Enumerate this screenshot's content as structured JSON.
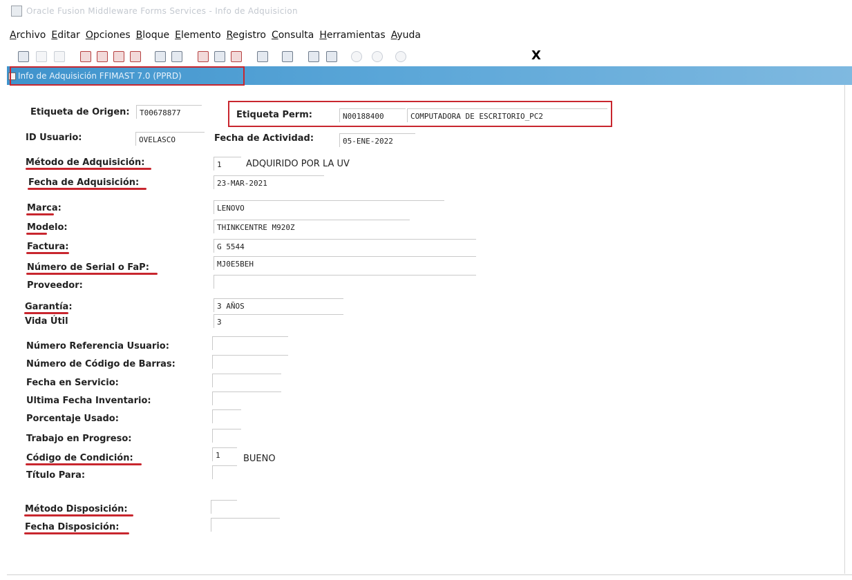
{
  "window": {
    "title": "Oracle Fusion Middleware Forms Services - Info de Adquisicion"
  },
  "menu": [
    {
      "pre": "",
      "mn": "A",
      "post": "rchivo"
    },
    {
      "pre": "",
      "mn": "E",
      "post": "ditar"
    },
    {
      "pre": "",
      "mn": "O",
      "post": "pciones"
    },
    {
      "pre": "",
      "mn": "B",
      "post": "loque"
    },
    {
      "pre": "",
      "mn": "E",
      "post": "lemento"
    },
    {
      "pre": "",
      "mn": "R",
      "post": "egistro"
    },
    {
      "pre": "",
      "mn": "C",
      "post": "onsulta"
    },
    {
      "pre": "",
      "mn": "H",
      "post": "erramientas"
    },
    {
      "pre": "",
      "mn": "A",
      "post": "yuda"
    }
  ],
  "toolbar": {
    "close_label": "X"
  },
  "form": {
    "title": "Info de Adquisición  FFIMAST  7.0  (PPRD)"
  },
  "fields": {
    "etiqueta_origen": {
      "label": "Etiqueta de Origen:",
      "value": "T00678877"
    },
    "etiqueta_perm": {
      "label": "Etiqueta Perm:",
      "code": "N00188400",
      "desc": "COMPUTADORA DE ESCRITORIO_PC2"
    },
    "id_usuario": {
      "label": "ID Usuario:",
      "value": "OVELASCO"
    },
    "fecha_actividad": {
      "label": "Fecha de Actividad:",
      "value": "05-ENE-2022"
    },
    "metodo_adquisicion": {
      "label": "Método de Adquisición:",
      "code": "1",
      "desc": "ADQUIRIDO POR LA UV"
    },
    "fecha_adquisicion": {
      "label": "Fecha de Adquisición:",
      "value": "23-MAR-2021"
    },
    "marca": {
      "label": "Marca:",
      "value": "LENOVO"
    },
    "modelo": {
      "label": "Modelo:",
      "value": "THINKCENTRE M920Z"
    },
    "factura": {
      "label": "Factura:",
      "value": "G 5544"
    },
    "serial": {
      "label": "Número de Serial o FaP:",
      "value": "MJ0E5BEH"
    },
    "proveedor": {
      "label": "Proveedor:",
      "value": ""
    },
    "garantia": {
      "label": "Garantía:",
      "value": "3 AÑOS"
    },
    "vida_util": {
      "label": "Vida Útil",
      "value": "3"
    },
    "num_ref_usuario": {
      "label": "Número Referencia Usuario:",
      "value": ""
    },
    "num_codigo_barras": {
      "label": "Número de Código de Barras:",
      "value": ""
    },
    "fecha_servicio": {
      "label": "Fecha en Servicio:",
      "value": ""
    },
    "ultima_fecha_inventario": {
      "label": "Ultima Fecha Inventario:",
      "value": ""
    },
    "porcentaje_usado": {
      "label": "Porcentaje Usado:",
      "value": ""
    },
    "trabajo_progreso": {
      "label": "Trabajo en Progreso:",
      "value": ""
    },
    "codigo_condicion": {
      "label": "Código de Condición:",
      "code": "1",
      "desc": "BUENO"
    },
    "titulo_para": {
      "label": "Título Para:",
      "value": ""
    },
    "metodo_disposicion": {
      "label": "Método Disposición:",
      "value": ""
    },
    "fecha_disposicion": {
      "label": "Fecha Disposición:",
      "value": ""
    }
  },
  "colors": {
    "highlight": "#c8262e",
    "form_header": "#3f93cc"
  }
}
